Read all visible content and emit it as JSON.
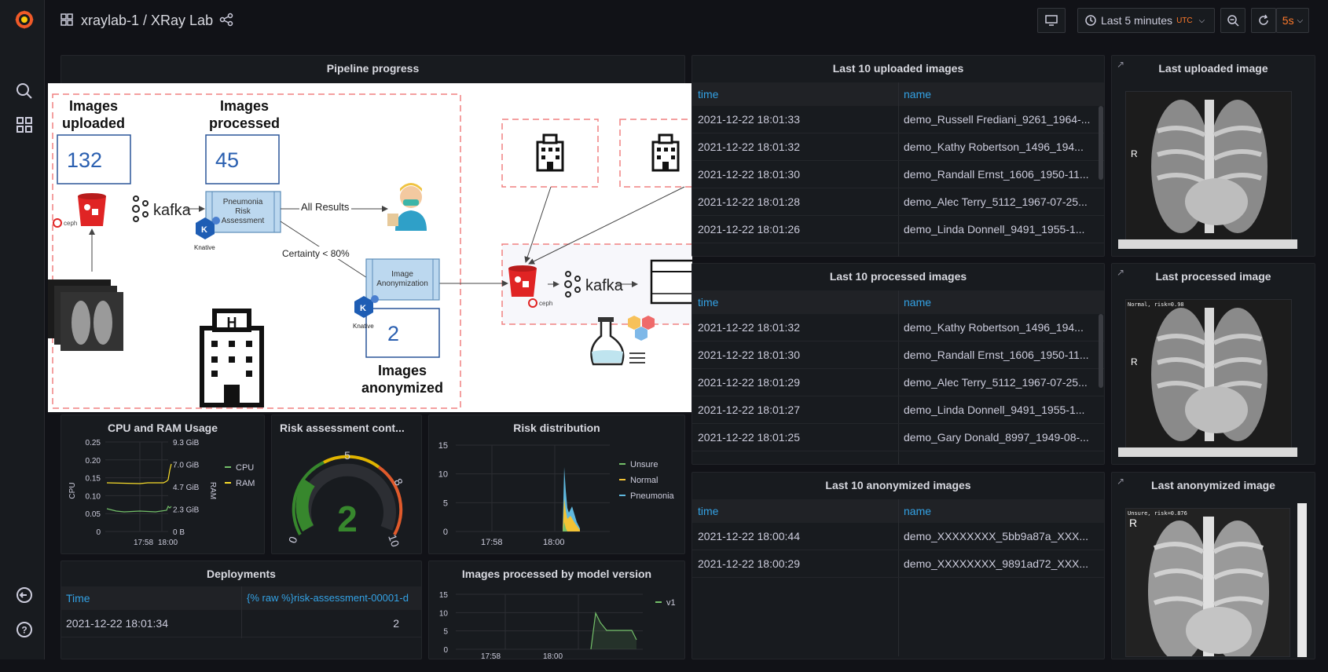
{
  "header": {
    "breadcrumb": "xraylab-1 / XRay Lab",
    "time_range": "Last 5 minutes",
    "time_zone": "UTC",
    "refresh": "5s"
  },
  "pipeline": {
    "title": "Pipeline progress",
    "uploaded_label": "Images\nuploaded",
    "uploaded_count": "132",
    "processed_label": "Images\nprocessed",
    "processed_count": "45",
    "anonymized_label": "Images\nanonymized",
    "anonymized_count": "2",
    "risk_box": "Pneumonia\nRisk\nAssessment",
    "anon_box": "Image\nAnonymization",
    "all_results": "All Results",
    "certainty": "Certainty < 80%",
    "kafka": "kafka",
    "ceph": "ceph",
    "knative": "Knative"
  },
  "uploaded_table": {
    "title": "Last 10 uploaded images",
    "col_time": "time",
    "col_name": "name",
    "rows": [
      {
        "time": "2021-12-22 18:01:33",
        "name": "demo_Russell Frediani_9261_1964-..."
      },
      {
        "time": "2021-12-22 18:01:32",
        "name": "demo_Kathy Robertson_1496_194..."
      },
      {
        "time": "2021-12-22 18:01:30",
        "name": "demo_Randall Ernst_1606_1950-11..."
      },
      {
        "time": "2021-12-22 18:01:28",
        "name": "demo_Alec Terry_5112_1967-07-25..."
      },
      {
        "time": "2021-12-22 18:01:26",
        "name": "demo_Linda Donnell_9491_1955-1..."
      }
    ]
  },
  "processed_table": {
    "title": "Last 10 processed images",
    "col_time": "time",
    "col_name": "name",
    "rows": [
      {
        "time": "2021-12-22 18:01:32",
        "name": "demo_Kathy Robertson_1496_194..."
      },
      {
        "time": "2021-12-22 18:01:30",
        "name": "demo_Randall Ernst_1606_1950-11..."
      },
      {
        "time": "2021-12-22 18:01:29",
        "name": "demo_Alec Terry_5112_1967-07-25..."
      },
      {
        "time": "2021-12-22 18:01:27",
        "name": "demo_Linda Donnell_9491_1955-1..."
      },
      {
        "time": "2021-12-22 18:01:25",
        "name": "demo_Gary Donald_8997_1949-08-..."
      }
    ]
  },
  "anonymized_table": {
    "title": "Last 10 anonymized images",
    "col_time": "time",
    "col_name": "name",
    "rows": [
      {
        "time": "2021-12-22 18:00:44",
        "name": "demo_XXXXXXXX_5bb9a87a_XXX..."
      },
      {
        "time": "2021-12-22 18:00:29",
        "name": "demo_XXXXXXXX_9891ad72_XXX..."
      }
    ]
  },
  "image_panels": {
    "uploaded": {
      "title": "Last uploaded image",
      "marker": "R"
    },
    "processed": {
      "title": "Last processed image",
      "marker": "R",
      "overlay": "Normal, risk=0.98"
    },
    "anonymized": {
      "title": "Last anonymized image",
      "marker": "R",
      "overlay": "Unsure, risk=0.876"
    }
  },
  "cpu_ram": {
    "title": "CPU and RAM Usage",
    "left_axis_label": "CPU",
    "right_axis_label": "RAM",
    "left_ticks": [
      "0.25",
      "0.20",
      "0.15",
      "0.10",
      "0.05",
      "0"
    ],
    "right_ticks": [
      "9.3 GiB",
      "7.0 GiB",
      "4.7 GiB",
      "2.3 GiB",
      "0 B"
    ],
    "x_ticks": [
      "17:58",
      "18:00"
    ],
    "legend": [
      "CPU",
      "RAM"
    ]
  },
  "gauge": {
    "title": "Risk assessment cont...",
    "value": "2",
    "min": "0",
    "max": "10",
    "tick_mid": "5",
    "tick_high": "8"
  },
  "risk_dist": {
    "title": "Risk distribution",
    "y_ticks": [
      "15",
      "10",
      "5",
      "0"
    ],
    "x_ticks": [
      "17:58",
      "18:00"
    ],
    "legend": [
      "Unsure",
      "Normal",
      "Pneumonia"
    ]
  },
  "deployments": {
    "title": "Deployments",
    "col_time": "Time",
    "col_rev": "{% raw %}risk-assessment-00001-d",
    "rows": [
      {
        "time": "2021-12-22 18:01:34",
        "value": "2"
      }
    ]
  },
  "model_version": {
    "title": "Images processed by model version",
    "y_ticks": [
      "15",
      "10",
      "5",
      "0"
    ],
    "x_ticks": [
      "17:58",
      "18:00"
    ],
    "legend": [
      "v1"
    ]
  },
  "colors": {
    "bg": "#111217",
    "panel": "#181b1f",
    "link": "#33a2e5",
    "green": "#73bf69",
    "yellow": "#fade2a",
    "blue": "#5794f2",
    "orange": "#ff780a"
  }
}
